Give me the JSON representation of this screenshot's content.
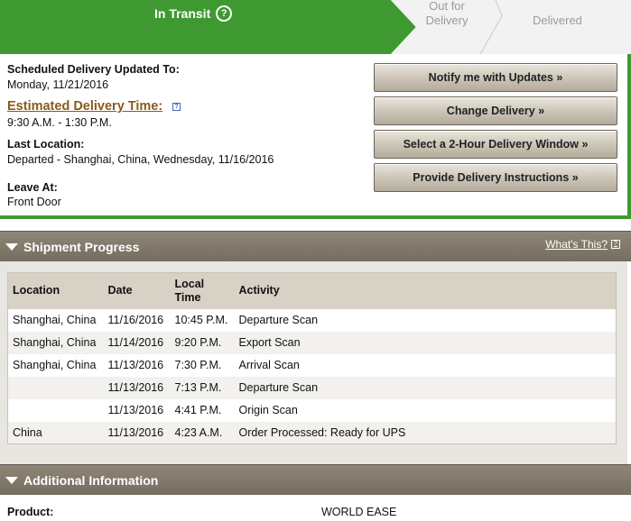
{
  "progress": {
    "current_step": "In Transit",
    "step2": "Out for\nDelivery",
    "step3": "Delivered"
  },
  "summary": {
    "scheduled_label": "Scheduled Delivery Updated To:",
    "scheduled_value": "Monday, 11/21/2016",
    "est_label": "Estimated Delivery Time:",
    "est_value": "9:30 A.M. - 1:30 P.M.",
    "last_loc_label": "Last Location:",
    "last_loc_value": "Departed - Shanghai, China, Wednesday, 11/16/2016",
    "leave_label": "Leave At:",
    "leave_value": "Front Door"
  },
  "buttons": {
    "notify": "Notify me with Updates »",
    "change": "Change Delivery »",
    "window": "Select a 2-Hour Delivery Window »",
    "instructions": "Provide Delivery Instructions »"
  },
  "shipment_progress": {
    "title": "Shipment Progress",
    "whats_this": "What's This?",
    "headers": [
      "Location",
      "Date",
      "Local\nTime",
      "Activity"
    ],
    "rows": [
      [
        "Shanghai, China",
        "11/16/2016",
        "10:45 P.M.",
        "Departure Scan"
      ],
      [
        "Shanghai, China",
        "11/14/2016",
        "9:20 P.M.",
        "Export Scan"
      ],
      [
        "Shanghai, China",
        "11/13/2016",
        "7:30 P.M.",
        "Arrival Scan"
      ],
      [
        "",
        "11/13/2016",
        "7:13 P.M.",
        "Departure Scan"
      ],
      [
        "",
        "11/13/2016",
        "4:41 P.M.",
        "Origin Scan"
      ],
      [
        "China",
        "11/13/2016",
        "4:23 A.M.",
        "Order Processed: Ready for UPS"
      ]
    ]
  },
  "additional": {
    "title": "Additional Information",
    "product_label": "Product:",
    "product_value": "WORLD EASE"
  }
}
